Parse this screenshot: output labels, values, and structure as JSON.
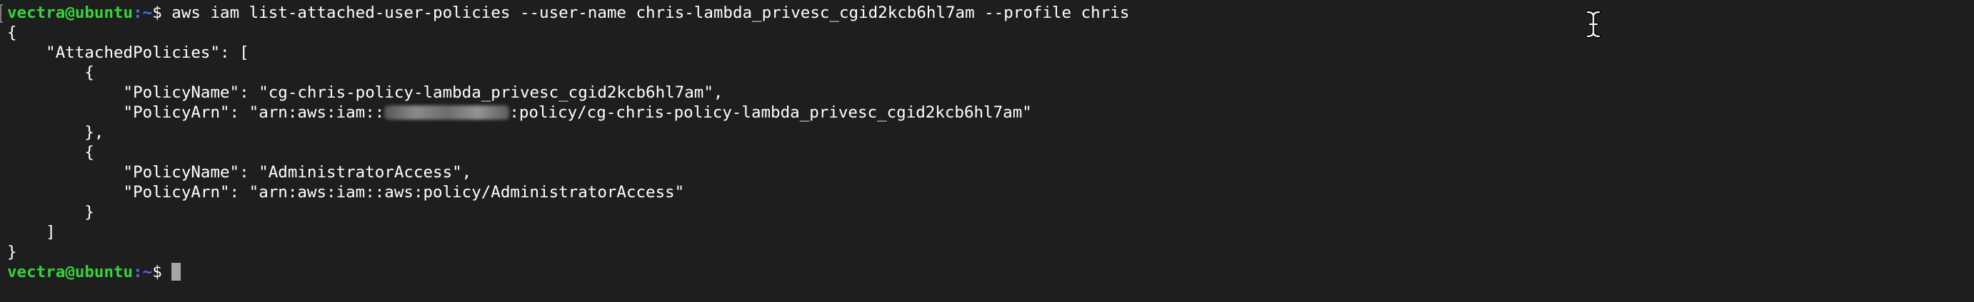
{
  "terminal": {
    "prompt": {
      "user_host": "vectra@ubuntu",
      "path": ":~",
      "symbol": "$ "
    },
    "command": "aws iam list-attached-user-policies --user-name chris-lambda_privesc_cgid2kcb6hl7am --profile chris",
    "output": [
      "{",
      "    \"AttachedPolicies\": [",
      "        {",
      "            \"PolicyName\": \"cg-chris-policy-lambda_privesc_cgid2kcb6hl7am\",",
      "            \"PolicyArn\": \"arn:aws:iam::",
      ":policy/cg-chris-policy-lambda_privesc_cgid2kcb6hl7am\"",
      "        },",
      "        {",
      "            \"PolicyName\": \"AdministratorAccess\",",
      "            \"PolicyArn\": \"arn:aws:iam::aws:policy/AdministratorAccess\"",
      "        }",
      "    ]",
      "}"
    ]
  },
  "icons": {
    "text_cursor": "ibeam-cursor-icon",
    "block_cursor": "block-cursor"
  },
  "colors": {
    "background": "#1e1e1e",
    "text": "#ffffff",
    "user_host": "#36d33b",
    "path": "#4a6cff",
    "cursor": "#a6a6a6"
  }
}
